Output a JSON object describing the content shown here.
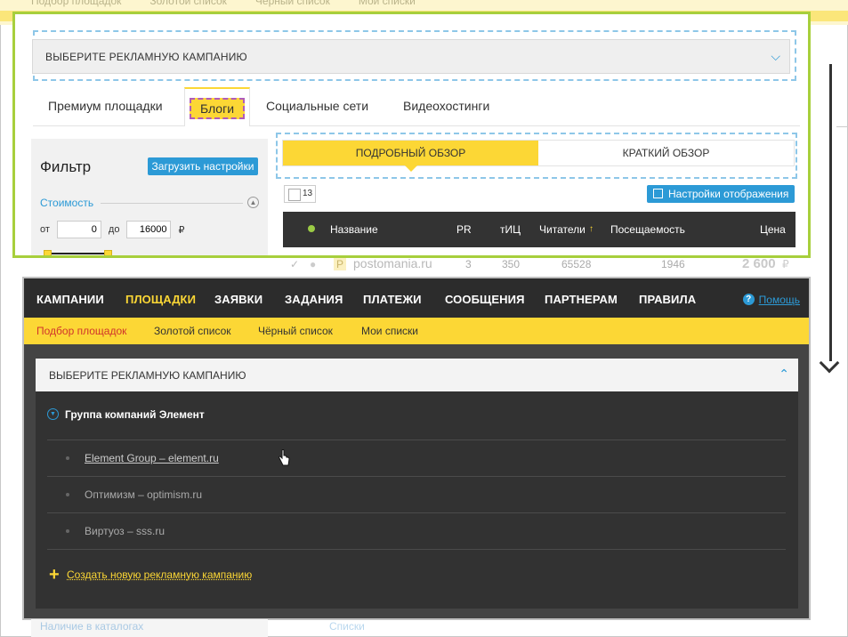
{
  "top_screen": {
    "subnav_items": [
      "Подбор площадок",
      "Золотой список",
      "Чёрный список",
      "Мои списки"
    ],
    "campaign_select_label": "ВЫБЕРИТЕ РЕКЛАМНУЮ КАМПАНИЮ",
    "tabs": [
      "Премиум площадки",
      "Блоги",
      "Социальные сети",
      "Видеохостинги"
    ],
    "active_tab": "Блоги",
    "filter": {
      "title": "Фильтр",
      "load_button": "Загрузить настройки",
      "cost_label": "Стоимость",
      "from_label": "от",
      "from_value": "0",
      "to_label": "до",
      "to_value": "16000",
      "currency": "₽"
    },
    "view_tabs": [
      "ПОДРОБНЫЙ ОБЗОР",
      "КРАТКИЙ ОБЗОР"
    ],
    "count": "13",
    "display_settings_button": "Настройки отображения",
    "table_headers": [
      "Название",
      "PR",
      "тИЦ",
      "Читатели",
      "Посещаемость",
      "Цена"
    ],
    "row": {
      "tag": "P",
      "site": "postomania.ru",
      "pr": "3",
      "tic": "350",
      "readers": "65528",
      "visits": "1946",
      "price": "2 600",
      "currency": "₽"
    }
  },
  "bottom_screen": {
    "main_nav": [
      "КАМПАНИИ",
      "ПЛОЩАДКИ",
      "ЗАЯВКИ",
      "ЗАДАНИЯ",
      "ПЛАТЕЖИ",
      "СООБЩЕНИЯ",
      "ПАРТНЕРАМ",
      "ПРАВИЛА"
    ],
    "active_main": "ПЛОЩАДКИ",
    "help": "Помощь",
    "sub_nav": [
      "Подбор площадок",
      "Золотой список",
      "Чёрный список",
      "Мои списки"
    ],
    "active_sub": "Подбор площадок",
    "dropdown_label": "ВЫБЕРИТЕ РЕКЛАМНУЮ КАМПАНИЮ",
    "group_name": "Группа компаний Элемент",
    "campaigns": [
      "Element Group – element.ru",
      "Оптимизм – optimism.ru",
      "Виртуоз – sss.ru"
    ],
    "create_campaign": "Создать новую рекламную кампанию"
  },
  "under_content": {
    "catalogs_label": "Наличие в каталогах",
    "lists_link": "Списки"
  },
  "colors": {
    "accent_yellow": "#fcd735",
    "accent_blue": "#2c9ad6",
    "highlight_green": "#a7cf3c",
    "dark_nav": "#2c2c2c"
  }
}
